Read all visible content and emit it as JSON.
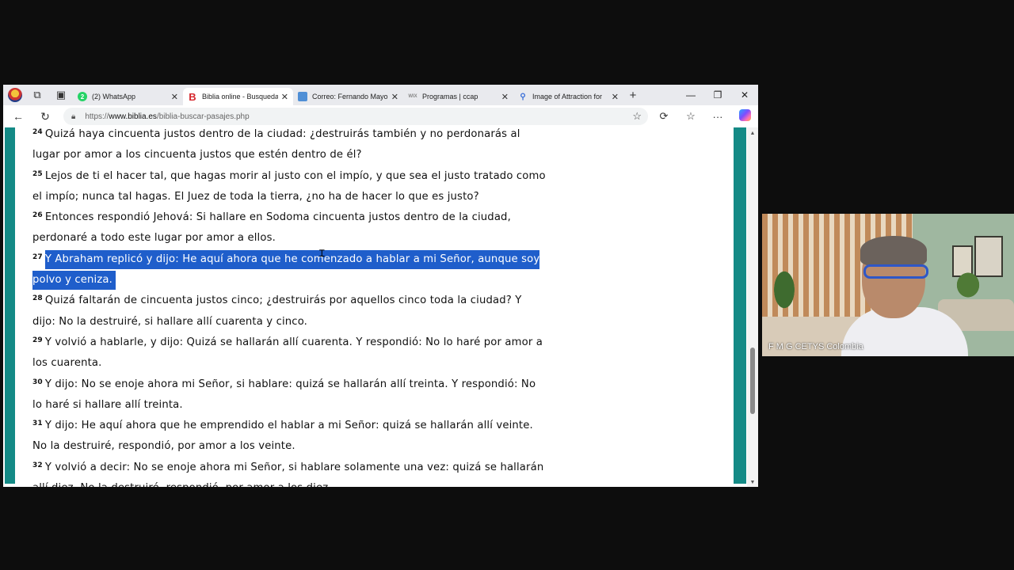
{
  "browser": {
    "tabs": [
      {
        "title": "(2) WhatsApp",
        "favicon": "whatsapp-icon",
        "active": false
      },
      {
        "title": "Biblia online - Busqueda",
        "favicon": "biblia-icon",
        "active": true
      },
      {
        "title": "Correo: Fernando Mayo",
        "favicon": "outlook-icon",
        "active": false
      },
      {
        "title": "Programas | ccap",
        "favicon": "wix-icon",
        "active": false
      },
      {
        "title": "Image of Attraction for",
        "favicon": "search-icon",
        "active": false
      }
    ],
    "url": {
      "scheme": "https://",
      "host": "www.biblia.es",
      "path": "/biblia-buscar-pasajes.php"
    }
  },
  "verses": [
    {
      "num": "24",
      "text": "Quizá haya cincuenta justos dentro de la ciudad: ¿destruirás también y no perdonarás al lugar por amor a los cincuenta justos que estén dentro de él?"
    },
    {
      "num": "25",
      "text": "Lejos de ti el hacer tal, que hagas morir al justo con el impío, y que sea el justo tratado como el impío; nunca tal hagas. El Juez de toda la tierra, ¿no ha de hacer lo que es justo?"
    },
    {
      "num": "26",
      "text": "Entonces respondió Jehová: Si hallare en Sodoma cincuenta justos dentro de la ciudad, perdonaré a todo este lugar por amor a ellos."
    },
    {
      "num": "27",
      "text": "Y Abraham replicó y dijo: He aquí ahora que he comenzado a hablar a mi Señor, aunque soy polvo y ceniza.",
      "highlighted": true
    },
    {
      "num": "28",
      "text": "Quizá faltarán de cincuenta justos cinco; ¿destruirás por aquellos cinco toda la ciudad? Y dijo: No la destruiré, si hallare allí cuarenta y cinco."
    },
    {
      "num": "29",
      "text": "Y volvió a hablarle, y dijo: Quizá se hallarán allí cuarenta. Y respondió: No lo haré por amor a los cuarenta."
    },
    {
      "num": "30",
      "text": "Y dijo: No se enoje ahora mi Señor, si hablare: quizá se hallarán allí treinta. Y respondió: No lo haré si hallare allí treinta."
    },
    {
      "num": "31",
      "text": "Y dijo: He aquí ahora que he emprendido el hablar a mi Señor: quizá se hallarán allí veinte. No la destruiré, respondió, por amor a los veinte."
    },
    {
      "num": "32",
      "text": "Y volvió a decir: No se enoje ahora mi Señor, si hablare solamente una vez: quizá se hallarán allí diez. No la destruiré, respondió, por amor a los diez."
    }
  ],
  "webcam": {
    "participant_name": "F M G CETYS Colombia"
  },
  "colors": {
    "accent_teal": "#148a86",
    "selection_blue": "#1f5ecb"
  }
}
